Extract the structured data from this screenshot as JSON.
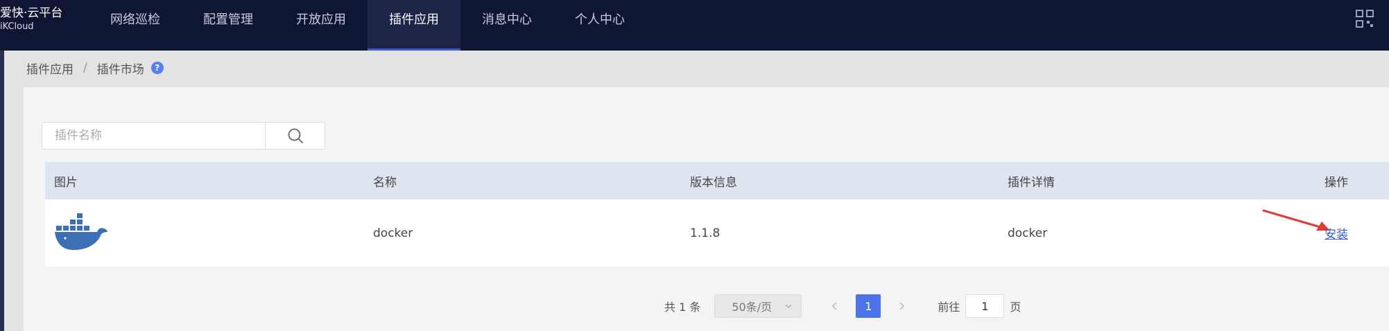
{
  "brand": {
    "name_cn": "爱快·云平台",
    "name_en": "iKCloud"
  },
  "nav": {
    "items": [
      {
        "label": "网络巡检"
      },
      {
        "label": "配置管理"
      },
      {
        "label": "开放应用"
      },
      {
        "label": "插件应用",
        "active": true
      },
      {
        "label": "消息中心"
      },
      {
        "label": "个人中心"
      }
    ],
    "apps_icon": "grid-icon"
  },
  "breadcrumb": {
    "root": "插件应用",
    "separator": "/",
    "current": "插件市场",
    "help": "?"
  },
  "search": {
    "placeholder": "插件名称",
    "value": ""
  },
  "table": {
    "headers": [
      "图片",
      "名称",
      "版本信息",
      "插件详情",
      "操作"
    ],
    "rows": [
      {
        "image": "docker-whale-icon",
        "name": "docker",
        "version": "1.1.8",
        "detail": "docker",
        "action": "安装"
      }
    ]
  },
  "pagination": {
    "total": "共 1 条",
    "page_size": "50条/页",
    "current_page": "1",
    "goto_label": "前往",
    "goto_value": "1",
    "page_suffix": "页"
  },
  "colors": {
    "nav_bg": "#0f1634",
    "accent": "#4c73e8",
    "link": "#3a5bd6",
    "arrow": "#e53935",
    "docker": "#3d6fb5"
  }
}
